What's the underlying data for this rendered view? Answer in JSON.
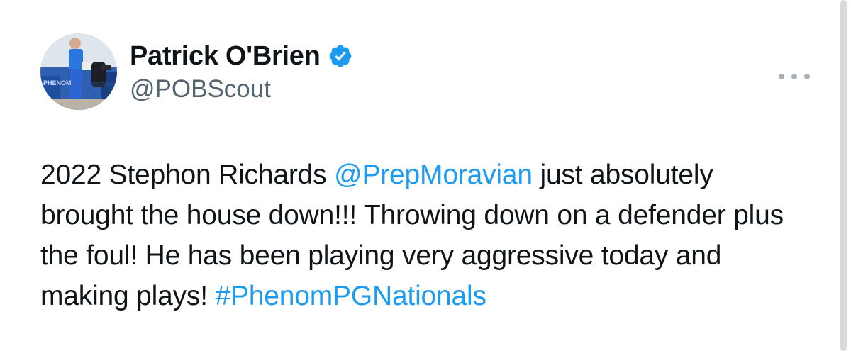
{
  "author": {
    "display_name": "Patrick O'Brien",
    "handle": "@POBScout",
    "verified": true,
    "avatar_caption": "PHENOM"
  },
  "tweet": {
    "segments": [
      {
        "text": "2022 Stephon Richards ",
        "type": "text"
      },
      {
        "text": "@PrepMoravian",
        "type": "mention"
      },
      {
        "text": " just absolutely brought the house down!!! Throwing down on a defender plus the foul! He has been playing very aggressive today and making plays! ",
        "type": "text"
      },
      {
        "text": "#PhenomPGNationals",
        "type": "hashtag"
      }
    ]
  },
  "icons": {
    "verified": "verified-badge-icon",
    "more": "more-options-icon"
  },
  "colors": {
    "link": "#1d9bf0",
    "verified": "#1d9bf0",
    "secondary_text": "#536471",
    "more_dots": "#a8b3bc"
  }
}
